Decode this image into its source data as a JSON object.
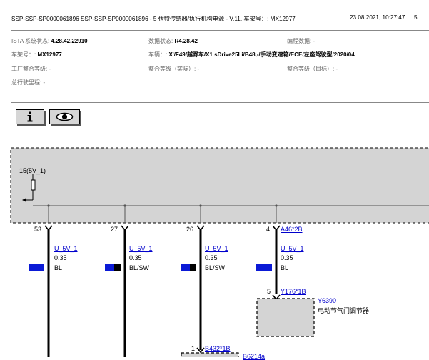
{
  "header": {
    "title": "SSP-SSP-SP0000061896 SSP-SSP-SP0000061896 - 5 伏特传感器/执行机构电源 - V.11, 车架号：: MX12977",
    "datetime": "23.08.2021, 10:27:47",
    "page": "5"
  },
  "info": {
    "ista_label": "ISTA 系统状态:",
    "ista_value": "4.28.42.22910",
    "data_label": "数据状态:",
    "data_value": "R4.28.42",
    "coding_label": "编程数据: -",
    "vin_label": "车架号：:",
    "vin_value": "MX12977",
    "vehicle_label": "车辆：:",
    "vehicle_value": "X'/F49/越野车/X1 sDrive25Li/B48,-/手动变速箱/ECE/左座驾驶型/2020/04",
    "factory_label": "工厂整合等级: -",
    "actual_label": "整合等级（实际）: -",
    "target_label": "整合等级（目标）: -",
    "mileage_label": "总行驶里程: -"
  },
  "toolbar": {
    "info_icon": "info-icon",
    "view_icon": "eye-icon"
  },
  "diagram": {
    "supply_label": "15(5V_1)",
    "wires": [
      {
        "pin": "53",
        "signal": "U_5V_1",
        "cross_section": "0.35",
        "color": "BL",
        "swatch": [
          "#0b1ad6",
          "#0b1ad6"
        ]
      },
      {
        "pin": "27",
        "signal": "U_5V_1",
        "cross_section": "0.35",
        "color": "BL/SW",
        "swatch": [
          "#0b1ad6",
          "#000000"
        ]
      },
      {
        "pin": "26",
        "signal": "U_5V_1",
        "cross_section": "0.35",
        "color": "BL/SW",
        "swatch": [
          "#0b1ad6",
          "#000000"
        ]
      },
      {
        "pin": "4",
        "signal": "U_5V_1",
        "cross_section": "0.35",
        "color": "BL",
        "swatch": [
          "#0b1ad6",
          "#0b1ad6"
        ],
        "connector": "A46*2B"
      }
    ],
    "components": [
      {
        "pin": "5",
        "connector": "Y176*1B",
        "code": "Y6390",
        "name": "电动节气门调节器"
      },
      {
        "pin": "1",
        "connector": "B432*1B",
        "code": "B6214a"
      }
    ]
  },
  "colors": {
    "link": "#0000cc",
    "box_fill": "#d4d4d4",
    "wire_blue": "#0b1ad6"
  }
}
